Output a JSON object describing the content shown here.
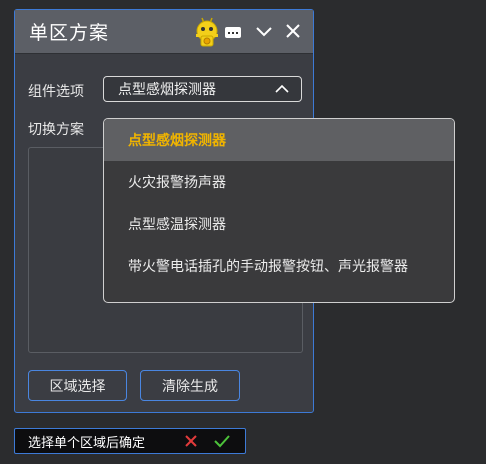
{
  "panel": {
    "title": "单区方案",
    "component_label": "组件选项",
    "selected_component": "点型感烟探测器",
    "switch_label": "切换方案",
    "buttons": {
      "area_select": "区域选择",
      "clear_generate": "清除生成"
    }
  },
  "dropdown": {
    "options": [
      "点型感烟探测器",
      "火灾报警扬声器",
      "点型感温探测器",
      "带火警电话插孔的手动报警按钮、声光报警器"
    ],
    "active_index": 0
  },
  "hint": {
    "text": "选择单个区域后确定"
  },
  "colors": {
    "accent_border": "#3d7ad6",
    "active_option": "#f0b400",
    "cancel": "#e23b3b",
    "confirm": "#4cc23a"
  }
}
